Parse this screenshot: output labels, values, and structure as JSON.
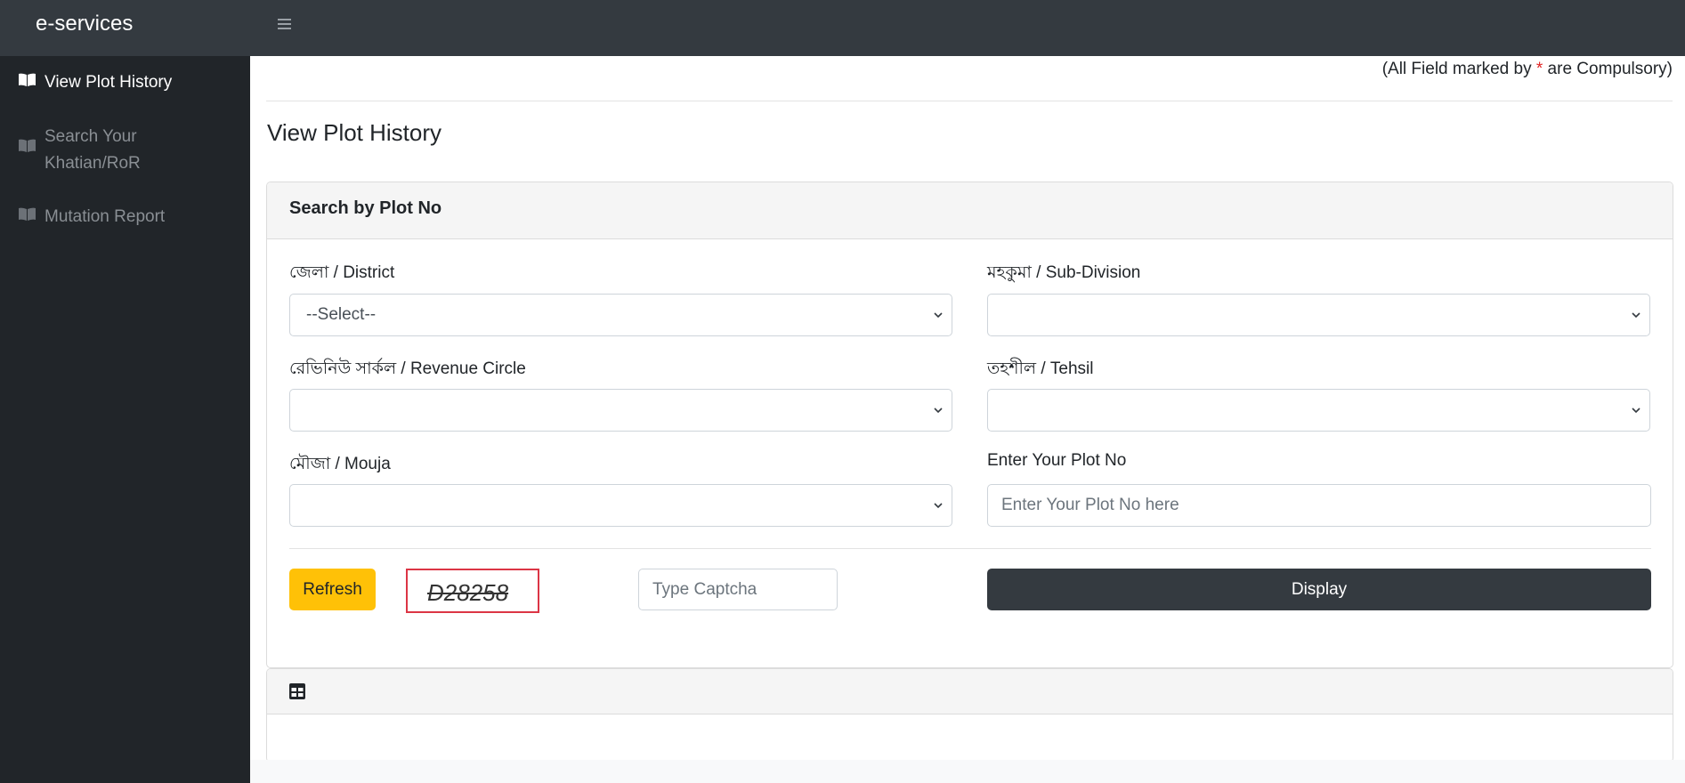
{
  "app": {
    "brand": "e-services"
  },
  "sidebar": {
    "items": [
      {
        "label": "View Plot History",
        "icon": "book-open-icon",
        "active": true
      },
      {
        "label": "Search Your Khatian/RoR",
        "icon": "book-open-icon",
        "active": false
      },
      {
        "label": "Mutation Report",
        "icon": "book-open-icon",
        "active": false
      }
    ]
  },
  "header": {
    "compulsory_prefix": "(All Field marked by ",
    "compulsory_star": "*",
    "compulsory_suffix": " are Compulsory)",
    "page_title": "View Plot History"
  },
  "search_card": {
    "title": "Search by Plot No",
    "fields": {
      "district": {
        "label": "জেলা / District",
        "value": "--Select--"
      },
      "sub_division": {
        "label": "মহকুমা / Sub-Division",
        "value": ""
      },
      "revenue_circle": {
        "label": "রেভিনিউ সার্কল / Revenue Circle",
        "value": ""
      },
      "tehsil": {
        "label": "তহশীল / Tehsil",
        "value": ""
      },
      "mouja": {
        "label": "মৌজা / Mouja",
        "value": ""
      },
      "plot_no": {
        "label": "Enter Your Plot No",
        "placeholder": "Enter Your Plot No here",
        "value": ""
      }
    },
    "refresh_label": "Refresh",
    "captcha_code": "D28258",
    "captcha_placeholder": "Type Captcha",
    "display_label": "Display"
  },
  "results_card": {
    "icon": "table-icon"
  },
  "colors": {
    "topbar": "#343a40",
    "sidebar": "#212529",
    "refresh": "#ffc107",
    "display": "#343a40",
    "captcha_border": "#dc3545",
    "required_star": "#e02424"
  }
}
